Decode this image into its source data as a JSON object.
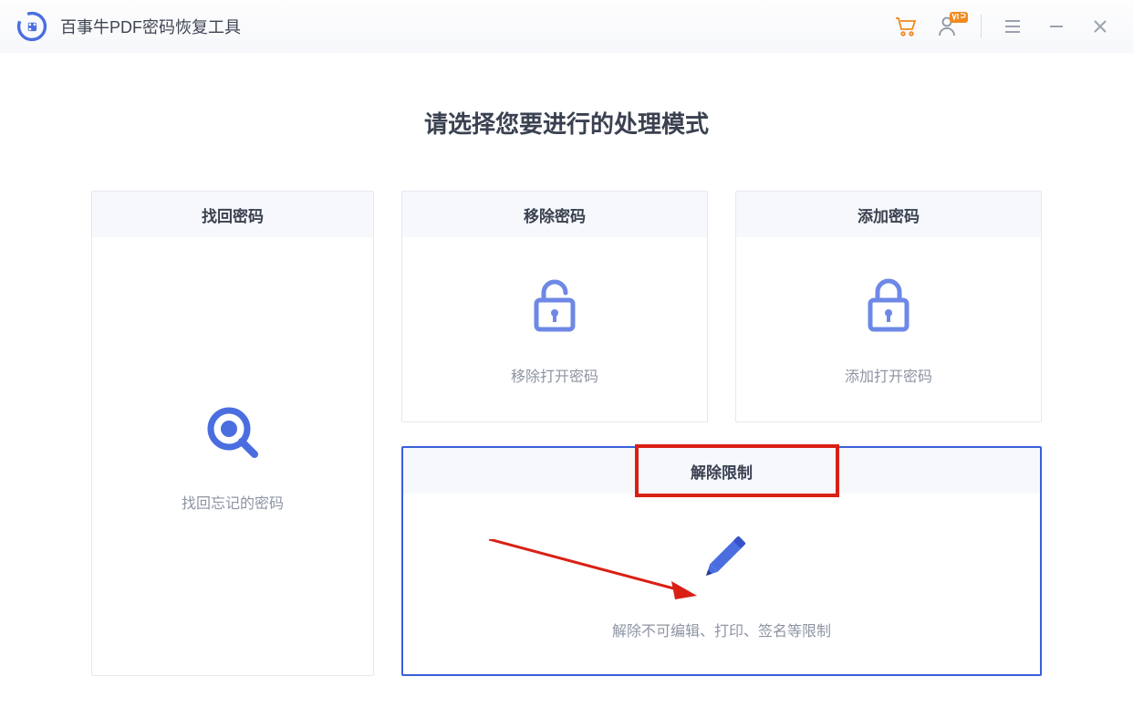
{
  "app_title": "百事牛PDF密码恢复工具",
  "heading": "请选择您要进行的处理模式",
  "cards": {
    "recover": {
      "title": "找回密码",
      "desc": "找回忘记的密码"
    },
    "remove": {
      "title": "移除密码",
      "desc": "移除打开密码"
    },
    "add": {
      "title": "添加密码",
      "desc": "添加打开密码"
    },
    "unlock": {
      "title": "解除限制",
      "desc": "解除不可编辑、打印、签名等限制"
    }
  },
  "colors": {
    "accent": "#4a6ee0",
    "orange": "#f08a1f",
    "red": "#d92015"
  }
}
